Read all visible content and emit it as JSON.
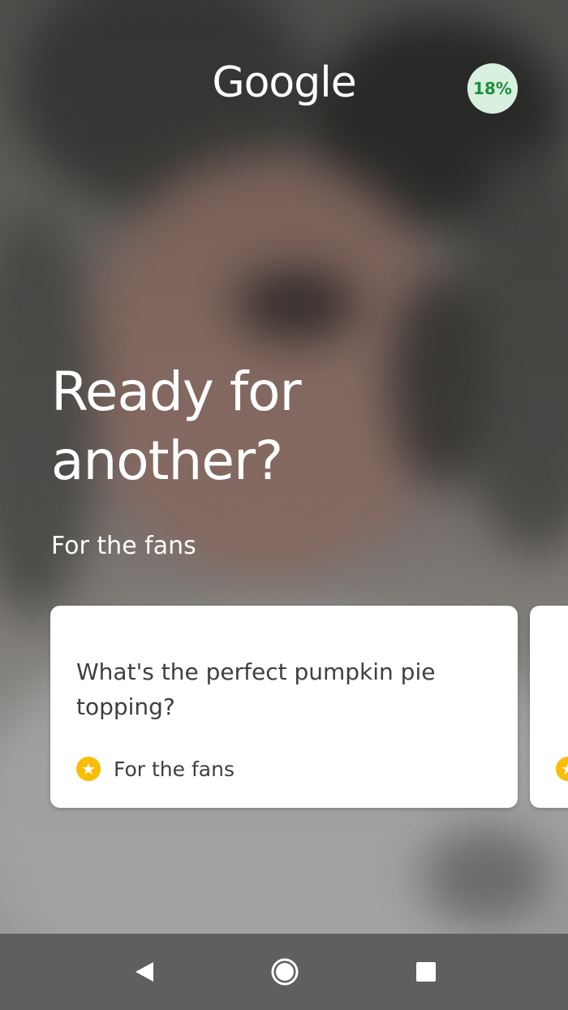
{
  "header": {
    "logo_text": "Google",
    "progress_percent": "18%",
    "progress_value": 0.18
  },
  "main": {
    "headline": "Ready for another?",
    "section_label": "For the fans"
  },
  "cards": [
    {
      "question": "What's the perfect pumpkin pie topping?",
      "category": "For the fans",
      "icon": "star-icon"
    },
    {
      "question": "",
      "category": "",
      "icon": "star-icon"
    }
  ],
  "navbar": {
    "back_icon": "back-icon",
    "home_icon": "home-icon",
    "recents_icon": "recents-icon"
  },
  "colors": {
    "progress_bg": "#d8f0de",
    "progress_text": "#1e8e3e",
    "star": "#fbbc04",
    "card_text": "#3c4043",
    "navbar": "#5f5f5f"
  }
}
